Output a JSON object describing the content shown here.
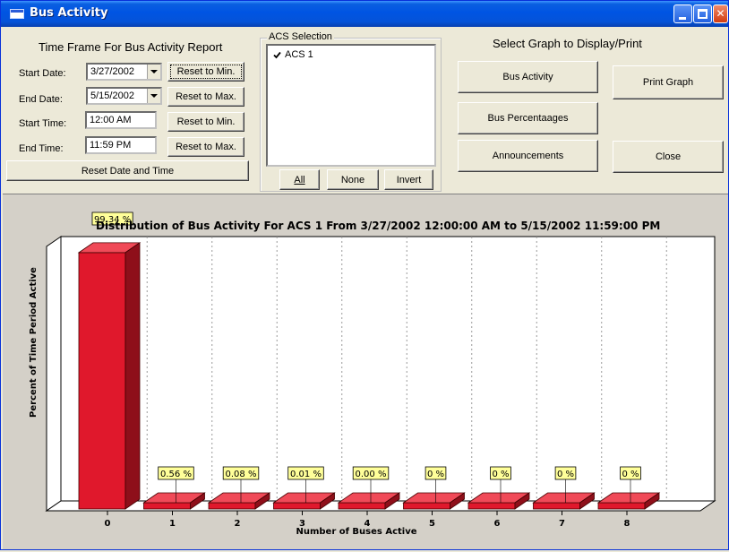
{
  "window": {
    "title": "Bus Activity"
  },
  "timeframe": {
    "heading": "Time Frame For Bus Activity Report",
    "start_date_label": "Start Date:",
    "start_date_value": "3/27/2002",
    "end_date_label": "End Date:",
    "end_date_value": "5/15/2002",
    "start_time_label": "Start Time:",
    "start_time_value": "12:00 AM",
    "end_time_label": "End Time:",
    "end_time_value": "11:59 PM",
    "reset_min_1": "Reset to Min.",
    "reset_max_1": "Reset to  Max.",
    "reset_min_2": "Reset to Min.",
    "reset_max_2": "Reset to  Max.",
    "reset_all": "Reset Date and Time"
  },
  "acs": {
    "group_title": "ACS Selection",
    "items": [
      {
        "label": "ACS 1",
        "checked": true
      }
    ],
    "all_label": "All",
    "none_label": "None",
    "invert_label": "Invert"
  },
  "graph_select": {
    "heading": "Select Graph to Display/Print",
    "bus_activity": "Bus Activity",
    "bus_percentages": "Bus Percentaages",
    "announcements": "Announcements",
    "print_graph": "Print Graph",
    "close": "Close"
  },
  "chart_data": {
    "type": "bar",
    "title": "Distribution of Bus Activity For ACS 1 From 3/27/2002 12:00:00 AM to 5/15/2002 11:59:00 PM",
    "xlabel": "Number of Buses Active",
    "ylabel": "Percent of Time Period Active",
    "categories": [
      "0",
      "1",
      "2",
      "3",
      "4",
      "5",
      "6",
      "7",
      "8"
    ],
    "values": [
      99.34,
      0.56,
      0.08,
      0.01,
      0.0,
      0,
      0,
      0,
      0
    ],
    "data_labels": [
      "99.34 %",
      "0.56 %",
      "0.08 %",
      "0.01 %",
      "0.00 %",
      "0 %",
      "0 %",
      "0 %",
      "0 %"
    ],
    "ylim": [
      0,
      100
    ],
    "bar_color": "#e0182c",
    "grid": true
  }
}
